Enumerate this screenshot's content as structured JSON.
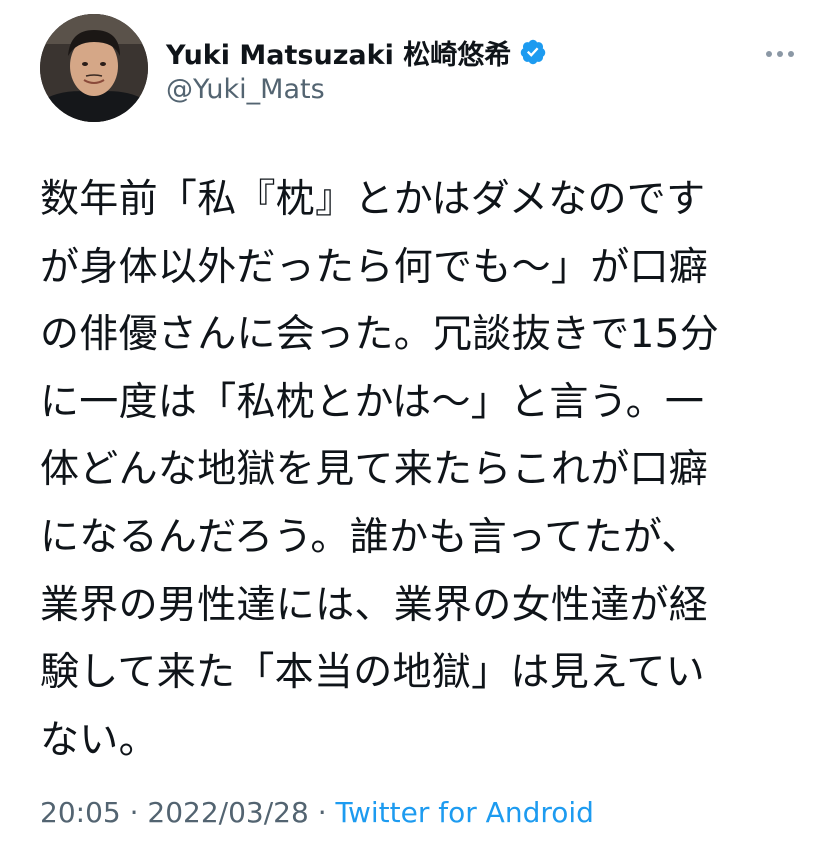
{
  "author": {
    "display_name": "Yuki Matsuzaki 松崎悠希",
    "handle": "@Yuki_Mats",
    "verified": true,
    "avatar_icon": "profile-photo"
  },
  "more_icon": "more-horizontal-icon",
  "tweet": {
    "lines": [
      "数年前「私『枕』とかはダメなのです",
      "が身体以外だったら何でも～」が口癖",
      "の俳優さんに会った。冗談抜きで15分",
      "に一度は「私枕とかは～」と言う。一",
      "体どんな地獄を見て来たらこれが口癖",
      "になるんだろう。誰かも言ってたが、",
      "業界の男性達には、業界の女性達が経",
      "験して来た「本当の地獄」は見えてい",
      "ない。"
    ]
  },
  "meta": {
    "time": "20:05",
    "separator": "·",
    "date": "2022/03/28",
    "source": "Twitter for Android"
  },
  "colors": {
    "text": "#0f1419",
    "secondary": "#536471",
    "link": "#1d9bf0",
    "verified": "#1d9bf0"
  }
}
